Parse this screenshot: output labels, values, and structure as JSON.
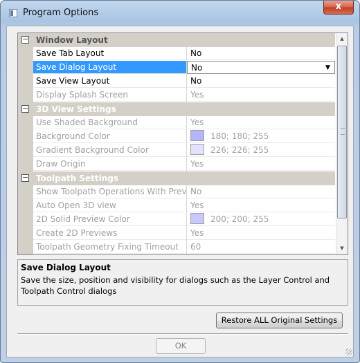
{
  "window": {
    "title": "Program Options",
    "close_label": "x"
  },
  "categories": [
    {
      "label": "Window Layout"
    },
    {
      "label": "3D View Settings"
    },
    {
      "label": "Toolpath Settings"
    }
  ],
  "rows": {
    "save_tab_layout": {
      "name": "Save Tab Layout",
      "value": "No"
    },
    "save_dialog_layout": {
      "name": "Save Dialog Layout",
      "value": "No"
    },
    "save_view_layout": {
      "name": "Save View Layout",
      "value": "No"
    },
    "display_splash": {
      "name": "Display Splash Screen",
      "value": "Yes"
    },
    "use_shaded_bg": {
      "name": "Use Shaded Background",
      "value": "Yes"
    },
    "background_color": {
      "name": "Background Color",
      "value": "180; 180; 255",
      "swatch": "#b4b4ff"
    },
    "gradient_bg_color": {
      "name": "Gradient Background Color",
      "value": "226; 226; 255",
      "swatch": "#e2e2ff"
    },
    "draw_origin": {
      "name": "Draw Origin",
      "value": "Yes"
    },
    "show_toolpath_ops": {
      "name": "Show Toolpath Operations With Previ",
      "value": "No"
    },
    "auto_open_3d": {
      "name": "Auto Open 3D view",
      "value": "Yes"
    },
    "solid_preview_color": {
      "name": "2D Solid Preview Color",
      "value": "200; 200; 255",
      "swatch": "#c8c8ff"
    },
    "create_2d_previews": {
      "name": "Create 2D Previews",
      "value": "Yes"
    },
    "geometry_timeout": {
      "name": "Toolpath Geometry Fixing Timeout",
      "value": "60"
    }
  },
  "description": {
    "title": "Save Dialog Layout",
    "text": "Save the size, position and visibility for dialogs such as the Layer Control and Toolpath Control dialogs"
  },
  "buttons": {
    "restore": "Restore ALL Original Settings",
    "ok": "OK"
  }
}
